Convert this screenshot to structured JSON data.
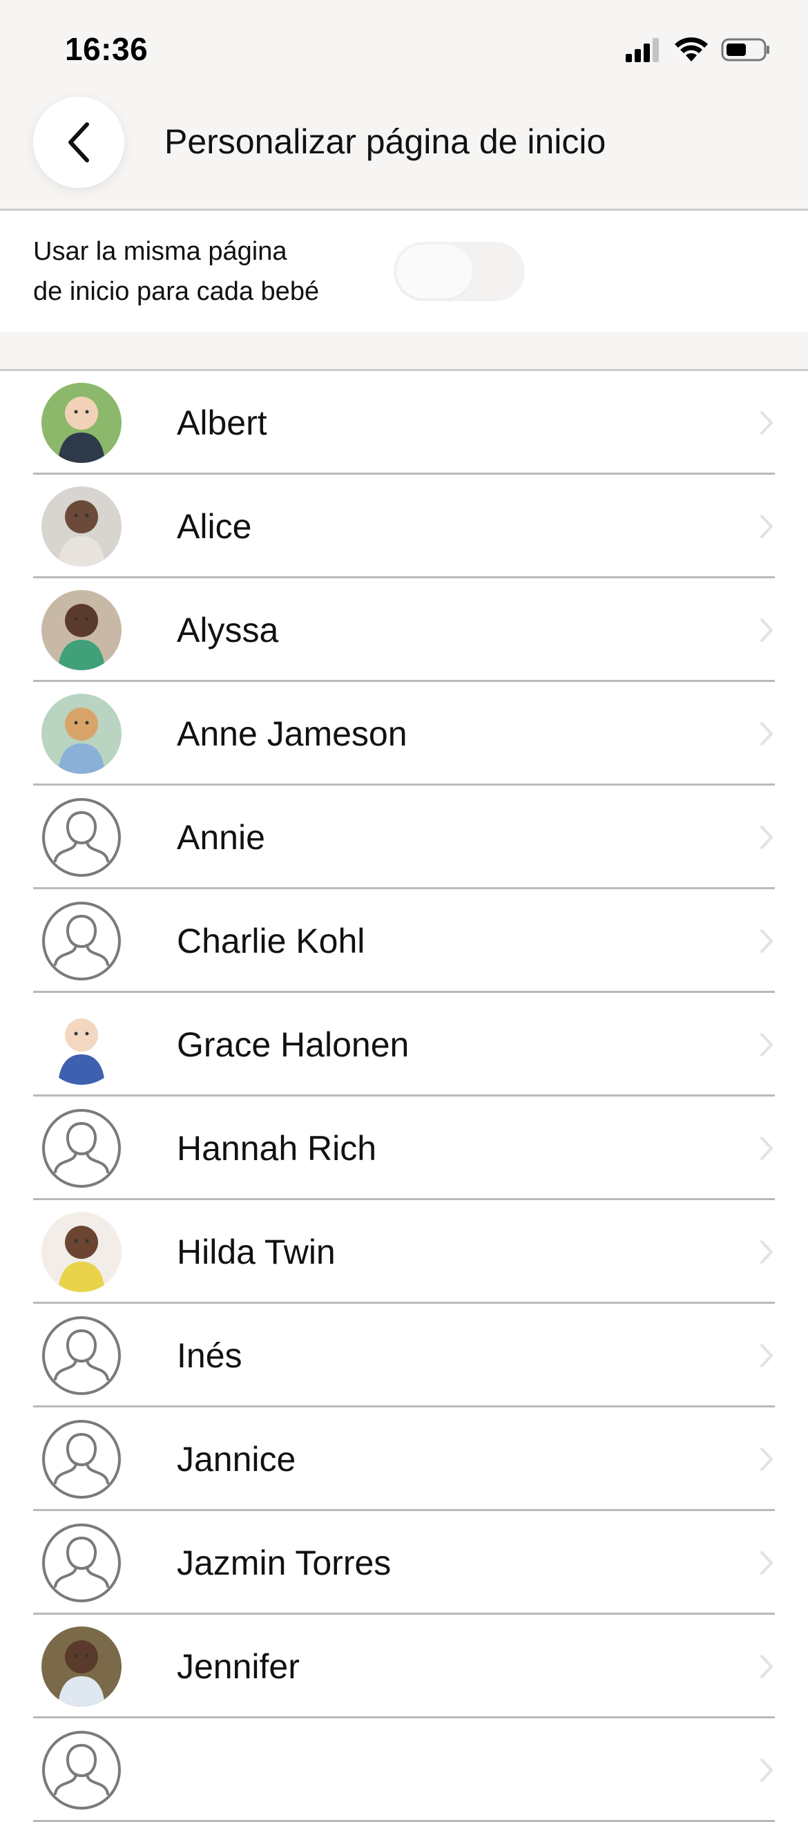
{
  "status_bar": {
    "time": "16:36"
  },
  "header": {
    "title": "Personalizar página de inicio"
  },
  "setting": {
    "label_line1": "Usar la misma página",
    "label_line2": "de inicio para cada bebé",
    "toggle_on": false
  },
  "babies": [
    {
      "name": "Albert",
      "avatar": "photo"
    },
    {
      "name": "Alice",
      "avatar": "photo"
    },
    {
      "name": "Alyssa",
      "avatar": "photo"
    },
    {
      "name": "Anne Jameson",
      "avatar": "photo"
    },
    {
      "name": "Annie",
      "avatar": "placeholder"
    },
    {
      "name": "Charlie Kohl",
      "avatar": "placeholder"
    },
    {
      "name": "Grace Halonen",
      "avatar": "photo"
    },
    {
      "name": "Hannah Rich",
      "avatar": "placeholder"
    },
    {
      "name": "Hilda Twin",
      "avatar": "photo"
    },
    {
      "name": "Inés",
      "avatar": "placeholder"
    },
    {
      "name": "Jannice",
      "avatar": "placeholder"
    },
    {
      "name": "Jazmin Torres",
      "avatar": "placeholder"
    },
    {
      "name": "Jennifer",
      "avatar": "photo"
    },
    {
      "name": "",
      "avatar": "placeholder"
    }
  ],
  "colors": {
    "background": "#f7f5f3",
    "divider": "#c9c9c9",
    "text": "#111111",
    "chevron": "#e2e2e2"
  }
}
